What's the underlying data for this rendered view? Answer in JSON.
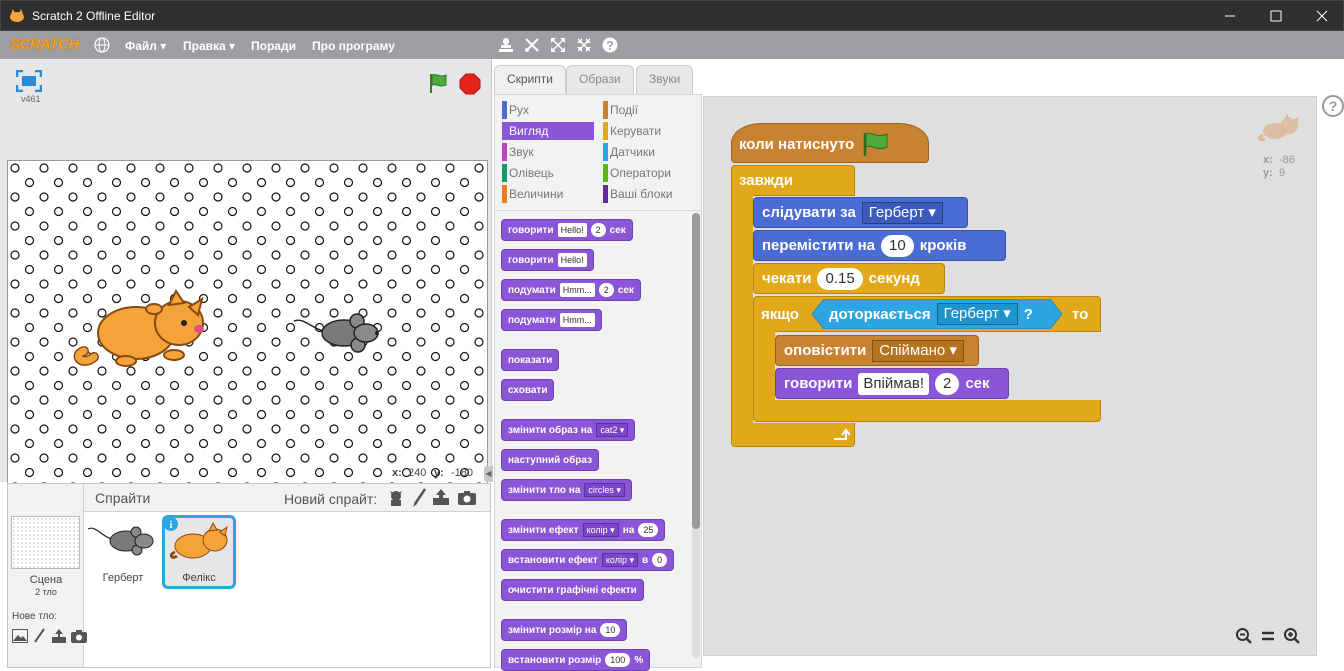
{
  "window": {
    "title": "Scratch 2 Offline Editor"
  },
  "menu": {
    "logo": "SCRATCH",
    "file": "Файл",
    "edit": "Правка",
    "tips": "Поради",
    "about": "Про програму"
  },
  "stage": {
    "version": "v461",
    "x_label": "x:",
    "x_value": "240",
    "y_label": "y:",
    "y_value": "-180"
  },
  "sprites": {
    "header": "Спрайти",
    "new_sprite": "Новий спрайт:",
    "scene_label": "Сцена",
    "scene_backdrops": "2 тло",
    "new_backdrop": "Нове тло:",
    "items": [
      {
        "name": "Герберт"
      },
      {
        "name": "Фелікс"
      }
    ]
  },
  "tabs": [
    "Скрипти",
    "Образи",
    "Звуки"
  ],
  "categories": {
    "left": [
      {
        "label": "Рух",
        "color": "#4a6cd4"
      },
      {
        "label": "Вигляд",
        "color": "#8a55d7"
      },
      {
        "label": "Звук",
        "color": "#bb42c3"
      },
      {
        "label": "Олівець",
        "color": "#0e9a6c"
      },
      {
        "label": "Величини",
        "color": "#ee7d16"
      }
    ],
    "right": [
      {
        "label": "Події",
        "color": "#c88330"
      },
      {
        "label": "Керувати",
        "color": "#e1a91a"
      },
      {
        "label": "Датчики",
        "color": "#2ca5e2"
      },
      {
        "label": "Оператори",
        "color": "#5cb712"
      },
      {
        "label": "Ваші блоки",
        "color": "#632d99"
      }
    ]
  },
  "palette": {
    "say_secs": {
      "text": "говорити",
      "arg": "Hello!",
      "num": "2",
      "unit": "сек"
    },
    "say": {
      "text": "говорити",
      "arg": "Hello!"
    },
    "think_secs": {
      "text": "подумати",
      "arg": "Hmm...",
      "num": "2",
      "unit": "сек"
    },
    "think": {
      "text": "подумати",
      "arg": "Hmm..."
    },
    "show": "показати",
    "hide": "сховати",
    "switch_costume": {
      "text": "змінити образ на",
      "arg": "cat2"
    },
    "next_costume": "наступний образ",
    "switch_backdrop": {
      "text": "змінити тло на",
      "arg": "circles"
    },
    "change_effect": {
      "text": "змінити ефект",
      "arg": "колір",
      "by": "на",
      "num": "25"
    },
    "set_effect": {
      "text": "встановити ефект",
      "arg": "колір",
      "to": "в",
      "num": "0"
    },
    "clear_effects": "очистити графічні ефекти",
    "change_size": {
      "text": "змінити розмір на",
      "num": "10"
    },
    "set_size": {
      "text": "встановити розмір",
      "num": "100",
      "unit": "%"
    }
  },
  "script": {
    "hat": "коли натиснуто",
    "forever": "завжди",
    "glide_to": {
      "text": "слідувати за",
      "arg": "Герберт"
    },
    "move": {
      "text": "перемістити на",
      "num": "10",
      "unit": "кроків"
    },
    "wait": {
      "text": "чекати",
      "num": "0.15",
      "unit": "секунд"
    },
    "if": {
      "text": "якщо",
      "then": "то"
    },
    "touching": {
      "text": "доторкається",
      "arg": "Герберт",
      "q": "?"
    },
    "broadcast": {
      "text": "оповістити",
      "arg": "Спіймано"
    },
    "say": {
      "text": "говорити",
      "arg": "Впіймав!",
      "num": "2",
      "unit": "сек"
    }
  },
  "sprite_info": {
    "x_label": "x:",
    "x_value": "-86",
    "y_label": "y:",
    "y_value": "9"
  },
  "colors": {
    "looks": "#8a55d7",
    "events": "#c88330",
    "control": "#e1a91a",
    "motion": "#4a6cd4",
    "sensing": "#2ca5e2",
    "selected_tab": "#2ca5e2"
  }
}
